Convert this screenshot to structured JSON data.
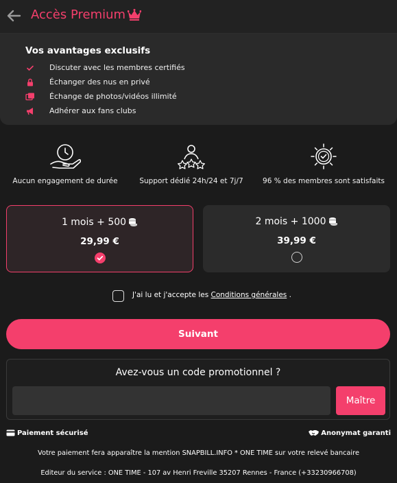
{
  "header": {
    "title": "Accès Premium",
    "accent_color": "#f43f6c",
    "back_icon": "arrow-left-icon",
    "title_icon": "crown-icon"
  },
  "benefits": {
    "title": "Vos avantages exclusifs",
    "items": [
      {
        "label": "Discuter avec les membres certifiés",
        "icon": "check-icon"
      },
      {
        "label": "Échanger des nus en privé",
        "icon": "lock-icon"
      },
      {
        "label": "Échange de photos/vidéos illimité",
        "icon": "photos-icon"
      },
      {
        "label": "Adhérer aux fans clubs",
        "icon": "megaphone-icon"
      }
    ]
  },
  "features": [
    {
      "label": "Aucun engagement de durée",
      "icon": "clock-hand-icon"
    },
    {
      "label": "Support dédié 24h/24 et 7j/7",
      "icon": "person-stars-icon"
    },
    {
      "label": "96 % des membres sont satisfaits",
      "icon": "badge-check-icon"
    }
  ],
  "plans": [
    {
      "name": "1 mois + 500",
      "price": "29,99 €",
      "selected": true
    },
    {
      "name": "2 mois + 1000",
      "price": "39,99 €",
      "selected": false
    }
  ],
  "terms": {
    "prefix": "J'ai lu et j'accepte les",
    "link": "Conditions générales",
    "suffix": ".",
    "checked": false
  },
  "next_button": "Suivant",
  "promo": {
    "question": "Avez-vous un code promotionnel ?",
    "value": "",
    "placeholder": "",
    "button": "Maître"
  },
  "footer": {
    "secure": "Paiement sécurisé",
    "anonymous": "Anonymat garanti",
    "mention": "Votre paiement fera apparaître la mention SNAPBILL.INFO * ONE TIME sur votre relevé bancaire",
    "editor": "Editeur du service : ONE TIME - 107 av Henri Freville 35207 Rennes - France (+33230966708)"
  }
}
